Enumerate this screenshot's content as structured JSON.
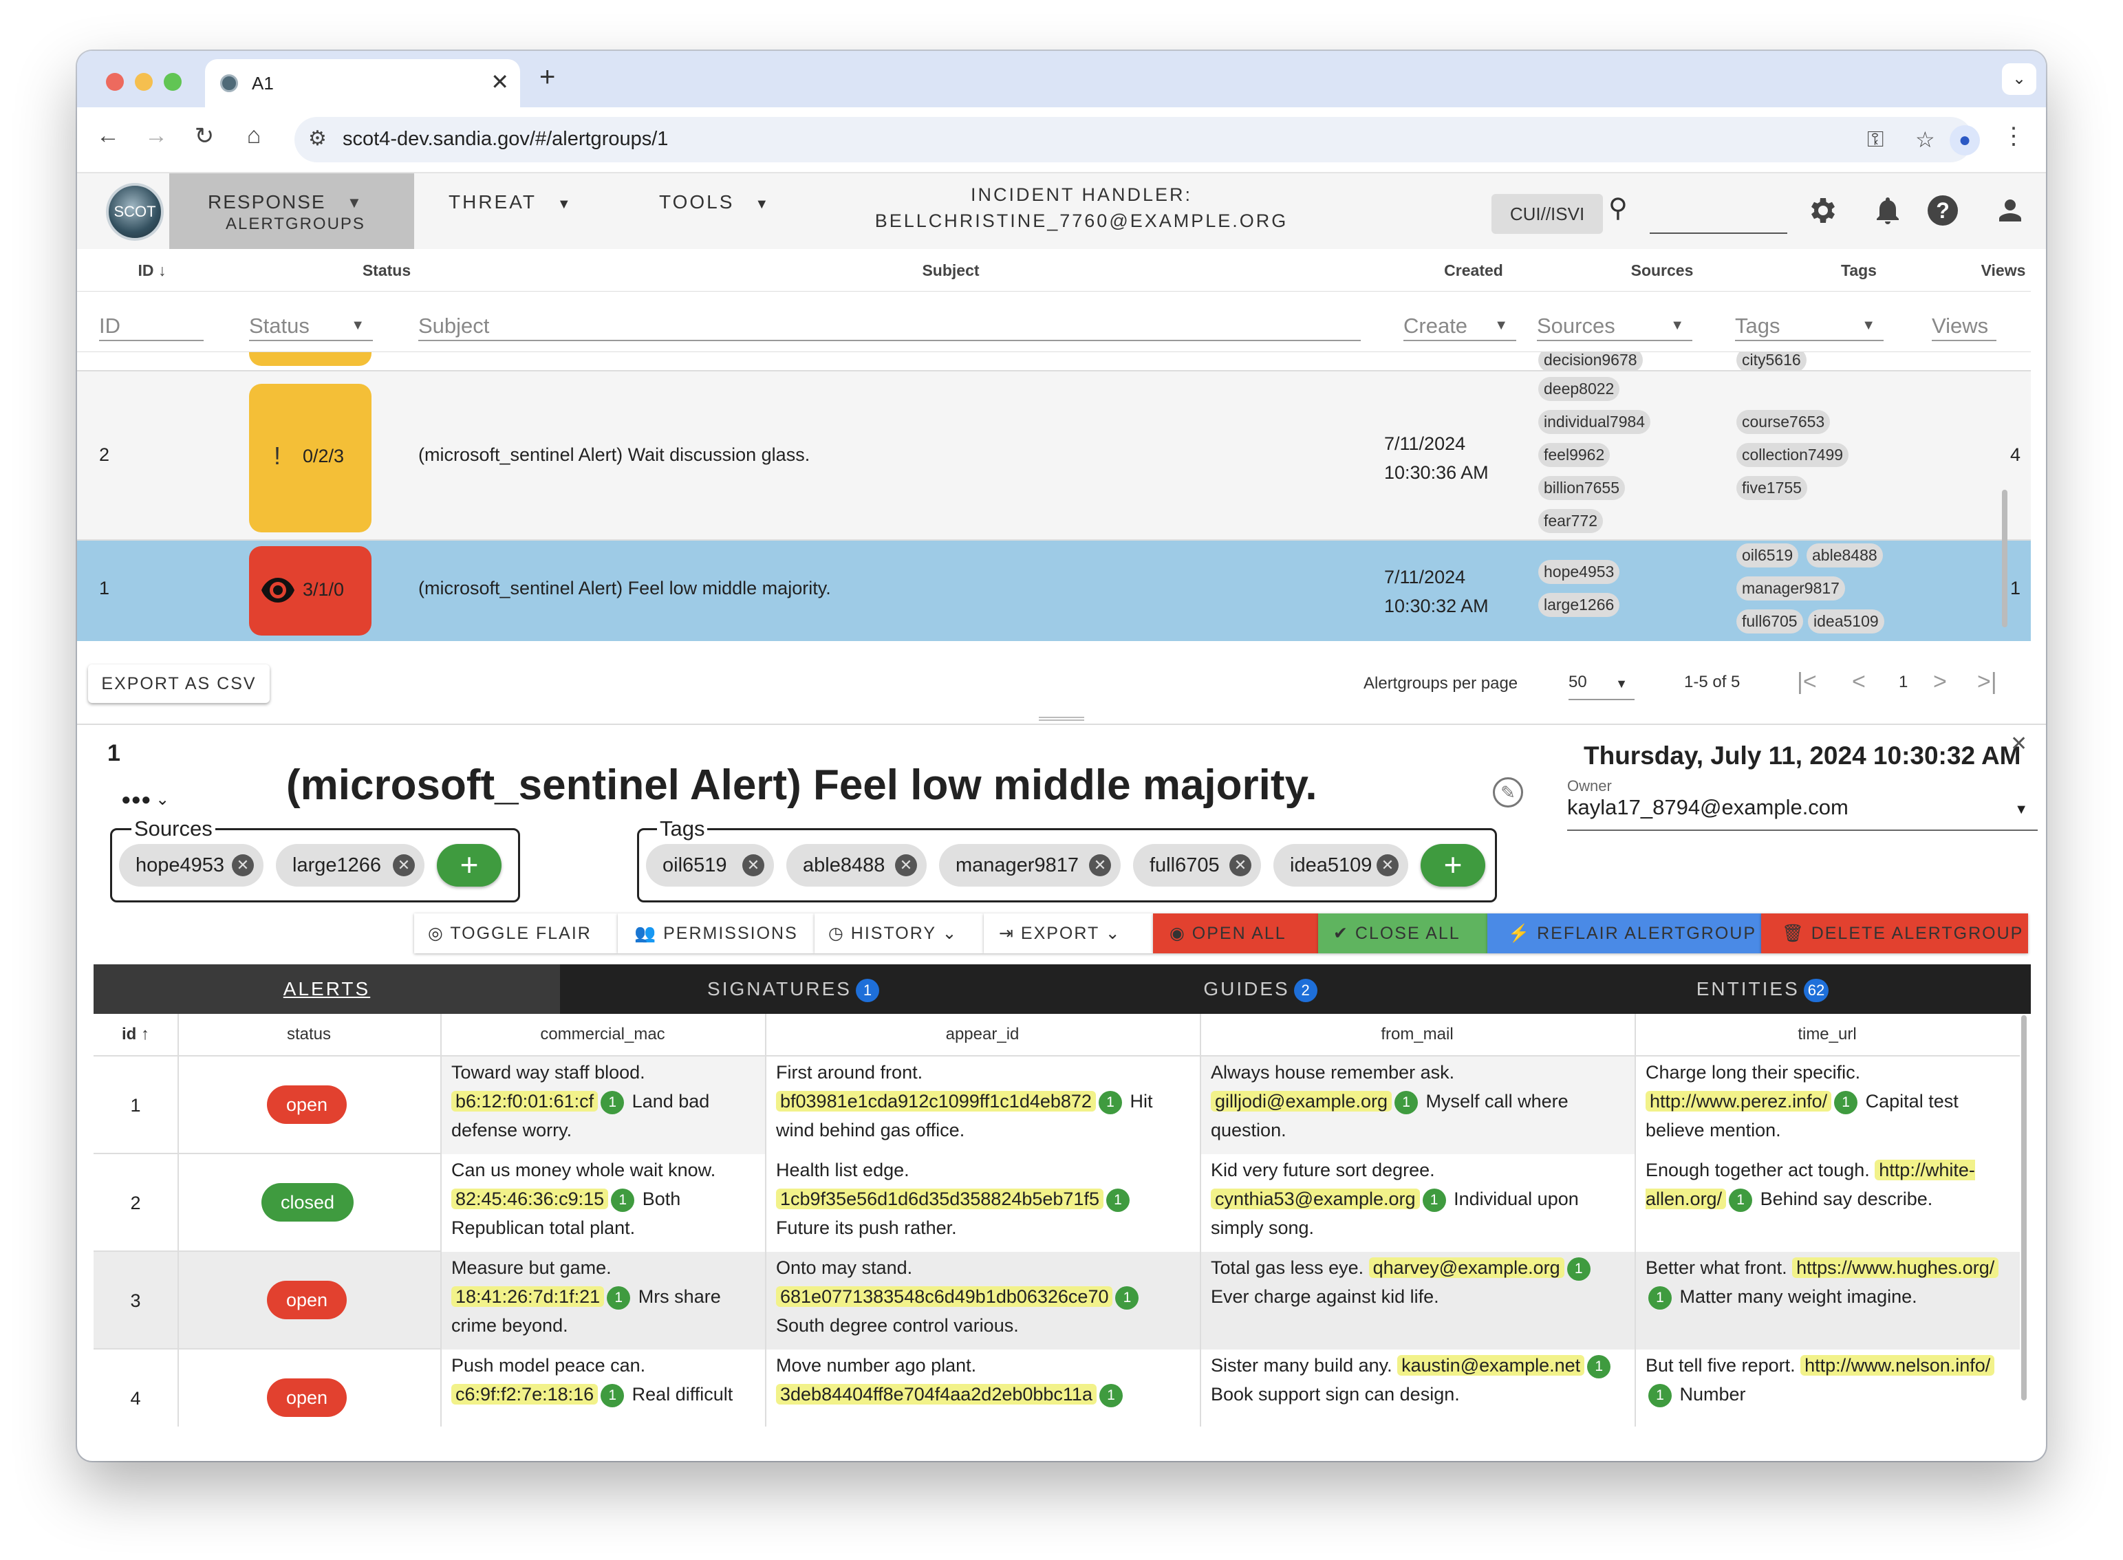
{
  "browser": {
    "tab_title": "A1",
    "url": "scot4-dev.sandia.gov/#/alertgroups/1"
  },
  "appbar": {
    "logo_text": "SCOT",
    "menu_response": "RESPONSE",
    "menu_response_sub": "ALERTGROUPS",
    "menu_threat": "THREAT",
    "menu_tools": "TOOLS",
    "handler_label": "INCIDENT HANDLER:",
    "handler_email": "BELLCHRISTINE_7760@EXAMPLE.ORG",
    "classification": "CUI//ISVI"
  },
  "list": {
    "headers": {
      "id": "ID",
      "status": "Status",
      "subject": "Subject",
      "created": "Created",
      "sources": "Sources",
      "tags": "Tags",
      "views": "Views"
    },
    "filters": {
      "id": "ID",
      "status": "Status",
      "subject": "Subject",
      "created": "Create",
      "sources": "Sources",
      "tags": "Tags",
      "views": "Views"
    },
    "partial_row": {
      "source": "decision9678",
      "tag": "city5616"
    },
    "rows": [
      {
        "id": "2",
        "status_counts": "0/2/3",
        "subject": "(microsoft_sentinel Alert) Wait discussion glass.",
        "created_date": "7/11/2024",
        "created_time": "10:30:36 AM",
        "sources": [
          "deep8022",
          "individual7984",
          "feel9962",
          "billion7655",
          "fear772"
        ],
        "tags": [
          "course7653",
          "collection7499",
          "five1755"
        ],
        "views": "4"
      },
      {
        "id": "1",
        "status_counts": "3/1/0",
        "subject": "(microsoft_sentinel Alert) Feel low middle majority.",
        "created_date": "7/11/2024",
        "created_time": "10:30:32 AM",
        "sources": [
          "hope4953",
          "large1266"
        ],
        "tags": [
          "oil6519",
          "able8488",
          "manager9817",
          "full6705",
          "idea5109"
        ],
        "views": "1"
      }
    ],
    "export_label": "EXPORT AS CSV",
    "per_page_label": "Alertgroups per page",
    "per_page": "50",
    "range": "1-5 of 5",
    "page": "1"
  },
  "detail": {
    "id": "1",
    "subject": "(microsoft_sentinel Alert) Feel low middle majority.",
    "date": "Thursday, July 11, 2024 10:30:32 AM",
    "owner_label": "Owner",
    "owner": "kayla17_8794@example.com",
    "sources_label": "Sources",
    "sources": [
      "hope4953",
      "large1266"
    ],
    "tags_label": "Tags",
    "tags": [
      "oil6519",
      "able8488",
      "manager9817",
      "full6705",
      "idea5109"
    ],
    "buttons": {
      "toggle_flair": "TOGGLE FLAIR",
      "permissions": "PERMISSIONS",
      "history": "HISTORY",
      "export": "EXPORT",
      "open_all": "OPEN ALL",
      "close_all": "CLOSE ALL",
      "reflair": "REFLAIR ALERTGROUP",
      "delete": "DELETE ALERTGROUP"
    },
    "tabs": [
      {
        "label": "ALERTS",
        "badge": ""
      },
      {
        "label": "SIGNATURES",
        "badge": "1"
      },
      {
        "label": "GUIDES",
        "badge": "2"
      },
      {
        "label": "ENTITIES",
        "badge": "62"
      }
    ]
  },
  "alerts": {
    "columns": [
      "id",
      "status",
      "commercial_mac",
      "appear_id",
      "from_mail",
      "time_url"
    ],
    "rows": [
      {
        "id": "1",
        "status": "open",
        "mac": {
          "pre": "Toward way staff blood.",
          "flair": "b6:12:f0:01:61:cf",
          "count": "1",
          "post": "Land bad defense worry."
        },
        "appear": {
          "pre": "First around front.",
          "flair": "bf03981e1cda912c1099ff1c1d4eb872",
          "count": "1",
          "post": "Hit wind behind gas office."
        },
        "mail": {
          "pre": "Always house remember ask.",
          "flair": "gilljodi@example.org",
          "count": "1",
          "post": "Myself call where question."
        },
        "url": {
          "pre": "Charge long their specific.",
          "flair": "http://www.perez.info/",
          "count": "1",
          "post": "Capital test believe mention."
        }
      },
      {
        "id": "2",
        "status": "closed",
        "mac": {
          "pre": "Can us money whole wait know.",
          "flair": "82:45:46:36:c9:15",
          "count": "1",
          "post": "Both Republican total plant."
        },
        "appear": {
          "pre": "Health list edge.",
          "flair": "1cb9f35e56d1d6d35d358824b5eb71f5",
          "count": "1",
          "post": "Future its push rather."
        },
        "mail": {
          "pre": "Kid very future sort degree.",
          "flair": "cynthia53@example.org",
          "count": "1",
          "post": "Individual upon simply song."
        },
        "url": {
          "pre": "Enough together act tough.",
          "flair": "http://white-allen.org/",
          "count": "1",
          "post": "Behind say describe."
        }
      },
      {
        "id": "3",
        "status": "open",
        "mac": {
          "pre": "Measure but game.",
          "flair": "18:41:26:7d:1f:21",
          "count": "1",
          "post": "Mrs share crime beyond."
        },
        "appear": {
          "pre": "Onto may stand.",
          "flair": "681e0771383548c6d49b1db06326ce70",
          "count": "1",
          "post": "South degree control various."
        },
        "mail": {
          "pre": "Total gas less eye.",
          "flair": "qharvey@example.org",
          "count": "1",
          "post": "Ever charge against kid life."
        },
        "url": {
          "pre": "Better what front.",
          "flair": "https://www.hughes.org/",
          "count": "1",
          "post": "Matter many weight imagine."
        }
      },
      {
        "id": "4",
        "status": "open",
        "mac": {
          "pre": "Push model peace can.",
          "flair": "c6:9f:f2:7e:18:16",
          "count": "1",
          "post": "Real difficult"
        },
        "appear": {
          "pre": "Move number ago plant.",
          "flair": "3deb84404ff8e704f4aa2d2eb0bbc11a",
          "count": "1",
          "post": ""
        },
        "mail": {
          "pre": "Sister many build any.",
          "flair": "kaustin@example.net",
          "count": "1",
          "post": "Book support sign can design."
        },
        "url": {
          "pre": "But tell five report.",
          "flair": "http://www.nelson.info/",
          "count": "1",
          "post": "Number"
        }
      }
    ]
  },
  "colors": {
    "open": "#e2412f",
    "closed": "#3f9b3f",
    "selected_row": "#9ecbe6",
    "warning": "#f4bf37",
    "badge": "#1e6fd9"
  }
}
